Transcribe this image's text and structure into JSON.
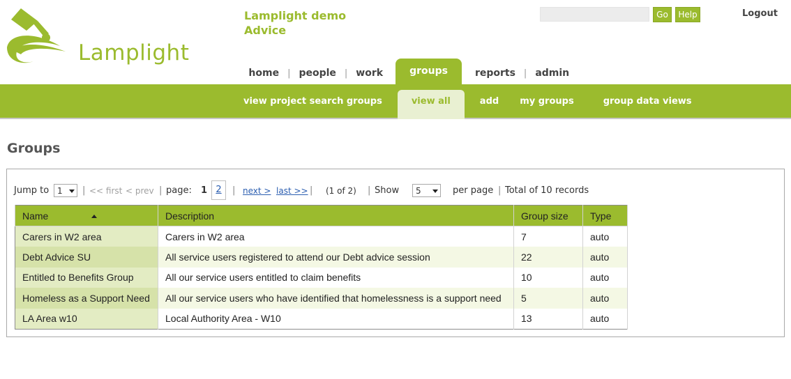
{
  "brand": {
    "logo_text": "Lamplight",
    "site_title_line1": "Lamplight demo",
    "site_title_line2": "Advice",
    "logo_color": "#9bbb2e"
  },
  "header": {
    "search_value": "",
    "go_label": "Go",
    "help_label": "Help",
    "logout_label": "Logout"
  },
  "main_nav": {
    "items": [
      {
        "label": "home"
      },
      {
        "label": "people"
      },
      {
        "label": "work"
      },
      {
        "label": "groups",
        "active": true
      },
      {
        "label": "reports"
      },
      {
        "label": "admin"
      }
    ],
    "separator": "|"
  },
  "sub_nav": {
    "items": [
      {
        "label": "view project search groups"
      },
      {
        "label": "view all",
        "active": true
      },
      {
        "label": "add"
      },
      {
        "label": "my groups"
      },
      {
        "label": "group data views"
      }
    ]
  },
  "page": {
    "title": "Groups"
  },
  "pager": {
    "jump_to_label": "Jump to",
    "jump_to_value": "1",
    "sep": "|",
    "first_label": "<< first",
    "prev_label": "< prev",
    "page_label": "page:",
    "current_page": "1",
    "other_page": "2",
    "next_label": "next >",
    "last_label": "last >>",
    "of_text": "(1 of 2)",
    "show_label": "Show",
    "show_value": "5",
    "per_page_label": "per page",
    "total_text": "Total of 10 records"
  },
  "table": {
    "columns": [
      "Name",
      "Description",
      "Group size",
      "Type"
    ],
    "rows": [
      [
        "Carers in W2 area",
        "Carers in W2 area",
        "7",
        "auto"
      ],
      [
        "Debt Advice SU",
        "All service users registered to attend our Debt advice session",
        "22",
        "auto"
      ],
      [
        "Entitled to Benefits Group",
        "All our service users entitled to claim benefits",
        "10",
        "auto"
      ],
      [
        "Homeless as a Support Need",
        "All our service users who have identified that homelessness is a support need",
        "5",
        "auto"
      ],
      [
        "LA Area w10",
        "Local Authority Area - W10",
        "13",
        "auto"
      ]
    ]
  }
}
